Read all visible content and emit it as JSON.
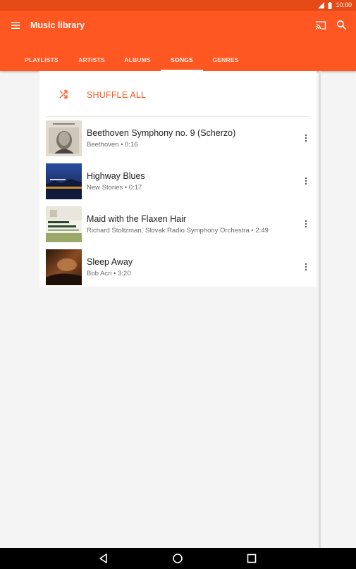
{
  "status": {
    "time": "10:00"
  },
  "appbar": {
    "title": "Music library"
  },
  "tabs": [
    {
      "label": "PLAYLISTS",
      "active": false
    },
    {
      "label": "ARTISTS",
      "active": false
    },
    {
      "label": "ALBUMS",
      "active": false
    },
    {
      "label": "SONGS",
      "active": true
    },
    {
      "label": "GENRES",
      "active": false
    }
  ],
  "shuffle": {
    "label": "SHUFFLE ALL"
  },
  "songs": [
    {
      "title": "Beethoven Symphony no. 9 (Scherzo)",
      "subtitle": "Beethoven • 0:16"
    },
    {
      "title": "Highway Blues",
      "subtitle": "New Stories • 0:17"
    },
    {
      "title": "Maid with the Flaxen Hair",
      "subtitle": "Richard Stoltzman, Slovak Radio Symphony Orchestra • 2:49"
    },
    {
      "title": "Sleep Away",
      "subtitle": "Bob Acri • 3:20"
    }
  ],
  "colors": {
    "accent": "#ff5722",
    "status_bar": "#e64a19"
  }
}
